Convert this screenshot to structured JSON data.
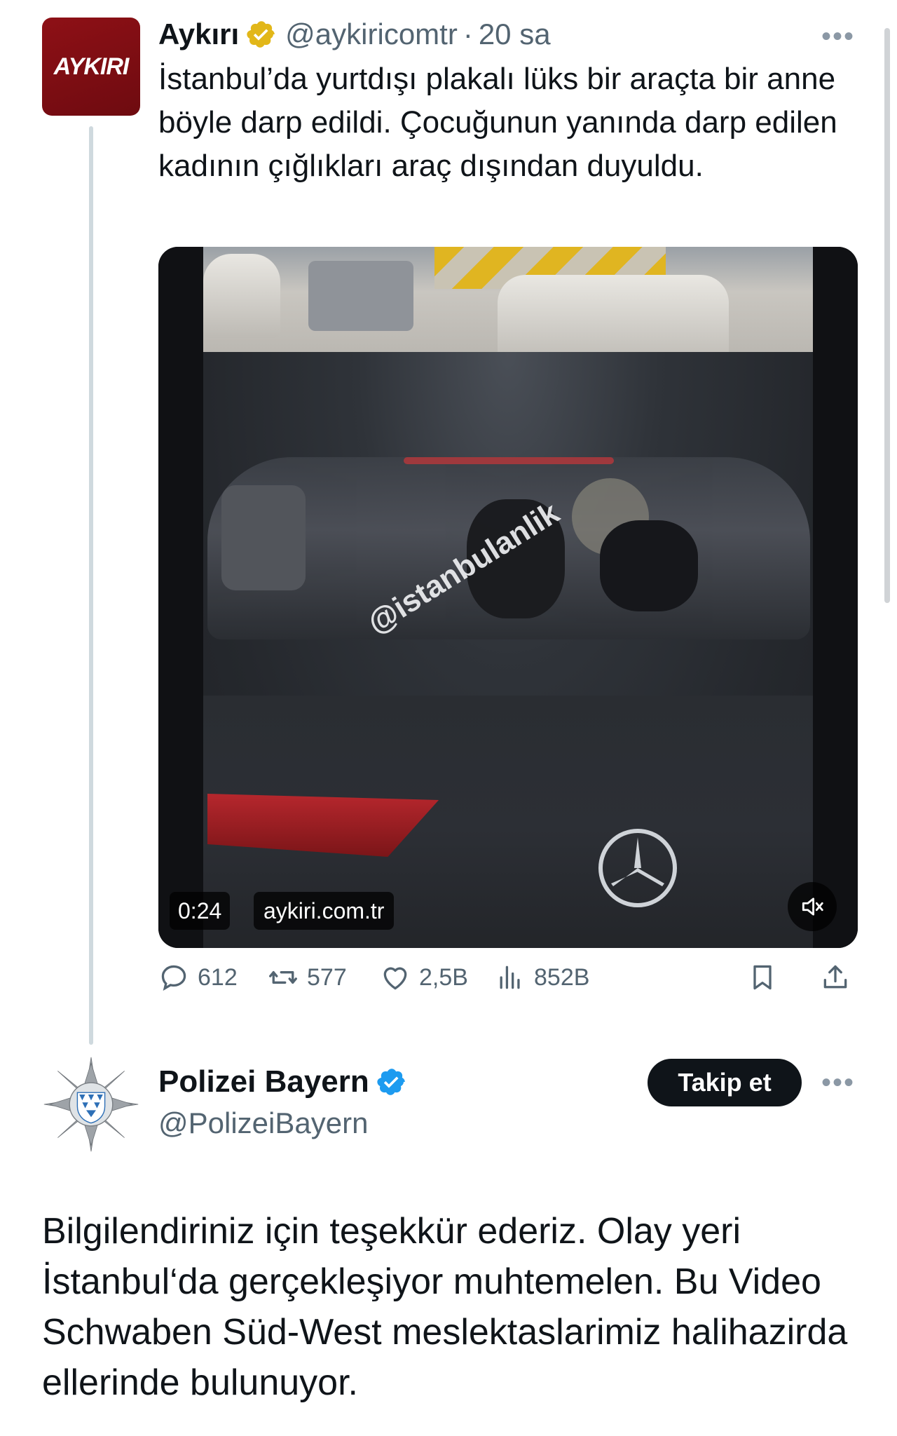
{
  "tweet1": {
    "avatar_text": "AYKIRI",
    "name": "Aykırı",
    "handle": "@aykiricomtr",
    "separator": "·",
    "time": "20 sa",
    "more": "•••",
    "text": "İstanbul’da yurtdışı plakalı lüks bir araçta bir anne böyle darp edildi. Çocuğunun yanında darp edilen kadının çığlıkları araç dışından duyuldu.",
    "video": {
      "watermark": "@istanbulanlik",
      "duration": "0:24",
      "source": "aykiri.com.tr",
      "mute_icon": "speaker-muted-icon"
    },
    "actions": {
      "replies": "612",
      "reposts": "577",
      "likes": "2,5B",
      "views": "852B"
    },
    "verified_color": "#e2b719"
  },
  "tweet2": {
    "name": "Polizei Bayern",
    "handle": "@PolizeiBayern",
    "follow_label": "Takip et",
    "more": "•••",
    "text": "Bilgilendiriniz için teşekkür ederiz. Olay yeri İstanbul‘da gerçekleşiyor muhtemelen. Bu Video Schwaben Süd-West meslektaslarimiz halihazirda ellerinde bulunuyor.",
    "verified_color": "#1d9bf0"
  }
}
